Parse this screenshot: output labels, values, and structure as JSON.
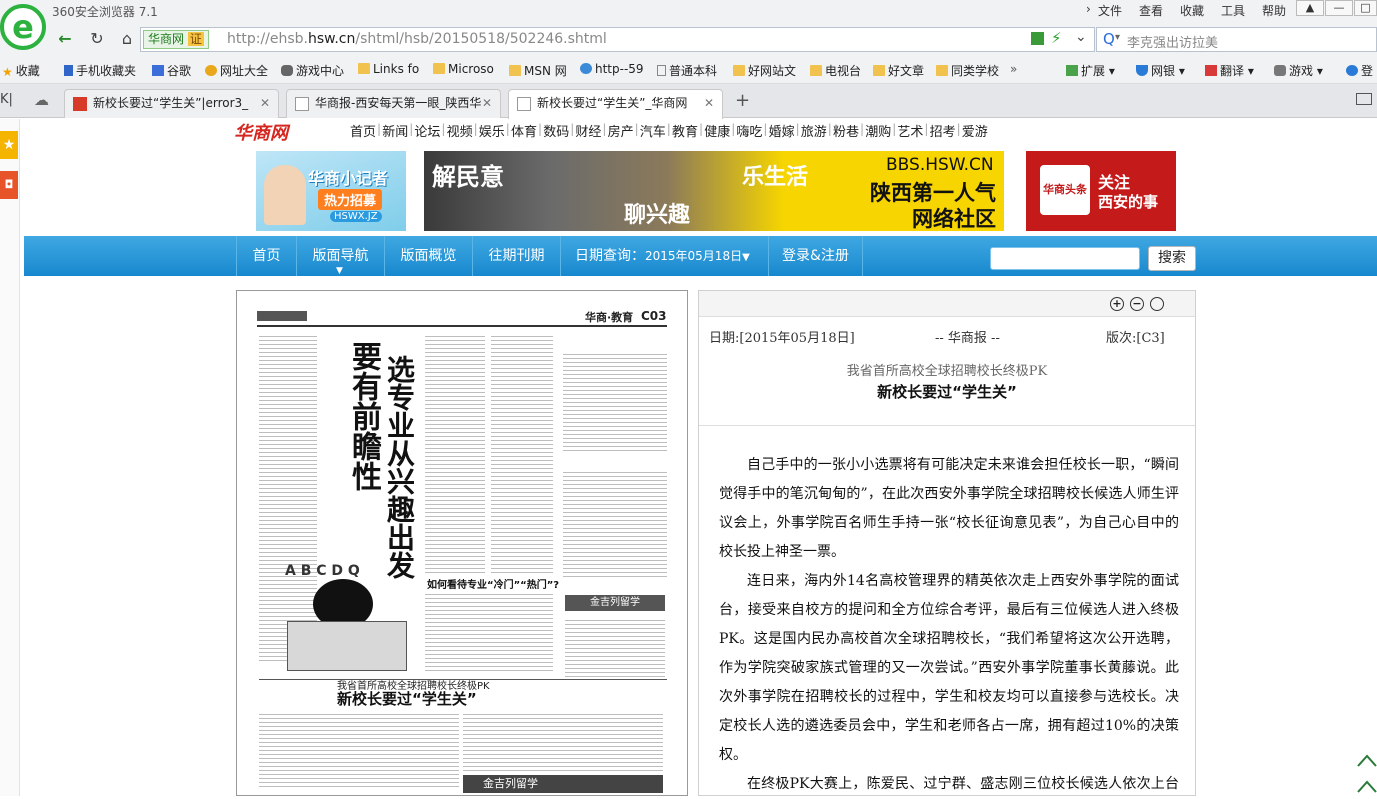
{
  "browser": {
    "app_title": "360安全浏览器 7.1",
    "menu": [
      "文件",
      "查看",
      "收藏",
      "工具",
      "帮助"
    ],
    "site_badge": "华商网",
    "site_badge_icon": "证",
    "url_prefix": "http://ehsb.",
    "url_domain": "hsw.cn",
    "url_path": "/shtml/hsb/20150518/502246.shtml",
    "search_placeholder": "李克强出访拉美"
  },
  "bookmarks": [
    {
      "label": "收藏",
      "icon": "star-icon"
    },
    {
      "label": "手机收藏夹",
      "icon": "phone-icon"
    },
    {
      "label": "谷歌",
      "icon": "google-icon"
    },
    {
      "label": "网址大全",
      "icon": "globe-icon"
    },
    {
      "label": "游戏中心",
      "icon": "gamepad-icon"
    },
    {
      "label": "Links fo",
      "icon": "folder-icon"
    },
    {
      "label": "Microso",
      "icon": "folder-icon"
    },
    {
      "label": "MSN 网",
      "icon": "folder-icon"
    },
    {
      "label": "http--59",
      "icon": "globe-icon"
    },
    {
      "label": "普通本科",
      "icon": "page-icon"
    },
    {
      "label": "好网站文",
      "icon": "folder-icon"
    },
    {
      "label": "电视台",
      "icon": "folder-icon"
    },
    {
      "label": "好文章",
      "icon": "folder-icon"
    },
    {
      "label": "同类学校",
      "icon": "folder-icon"
    }
  ],
  "bookmarks_right": [
    "扩展",
    "网银",
    "翻译",
    "游戏",
    "登"
  ],
  "tabs": [
    {
      "label": "新校长要过“学生关”|error3_"
    },
    {
      "label": "华商报-西安每天第一眼_陕西华"
    },
    {
      "label": "新校长要过“学生关”_华商网"
    }
  ],
  "site": {
    "logo": "华商网",
    "nav": [
      "首页",
      "新闻",
      "论坛",
      "视频",
      "娱乐",
      "体育",
      "数码",
      "财经",
      "房产",
      "汽车",
      "教育",
      "健康",
      "嗨吃",
      "婚嫁",
      "旅游",
      "粉巷",
      "潮购",
      "艺术",
      "招考",
      "爱游"
    ]
  },
  "banners": {
    "left_title": "华商小记者",
    "left_sub": "热力招募",
    "left_tag": "HSWX.JZ",
    "mid_a": "解民意",
    "mid_b": "聊兴趣",
    "mid_c": "乐生活",
    "mid_url": "BBS.HSW.CN",
    "mid_d": "陕西第一人气",
    "mid_e": "网络社区",
    "right_logo": "华商头条",
    "right_a": "关注",
    "right_b": "西安的事"
  },
  "blue_nav": {
    "items": [
      "首页",
      "版面导航",
      "版面概览",
      "往期刊期"
    ],
    "date_label": "日期查询：",
    "date_value": "2015年05月18日",
    "login": "登录&注册",
    "search_button": "搜索"
  },
  "paper": {
    "masthead": "华商·教育",
    "page_no": "C03",
    "headline_1": "要有前瞻性",
    "headline_2": "选专业从兴趣出发",
    "kicker": "我省首所高校全球招聘校长终极PK",
    "bottom_title": "新校长要过“学生关”",
    "side_title": "如何看待专业“冷门”“热门”?",
    "ad_1": "金吉列留学",
    "ad_2": "金吉列留学"
  },
  "article": {
    "date": "日期:[2015年05月18日]",
    "source": "-- 华商报 --",
    "edition": "版次:[C3]",
    "subtitle": "我省首所高校全球招聘校长终极PK",
    "title": "新校长要过“学生关”",
    "paragraphs": [
      "自己手中的一张小小选票将有可能决定未来谁会担任校长一职，“瞬间觉得手中的笔沉甸甸的”，在此次西安外事学院全球招聘校长候选人师生评议会上，外事学院百名师生手持一张“校长征询意见表”，为自己心目中的校长投上神圣一票。",
      "连日来，海内外14名高校管理界的精英依次走上西安外事学院的面试台，接受来自校方的提问和全方位综合考评，最后有三位候选人进入终极PK。这是国内民办高校首次全球招聘校长，“我们希望将这次公开选聘，作为学院突破家族式管理的又一次尝试。”西安外事学院董事长黄藤说。此次外事学院在招聘校长的过程中，学生和校友均可以直接参与选校长。决定校长人选的遴选委员会中，学生和老师各占一席，拥有超过10%的决策权。",
      "在终极PK大赛上，陈爱民、过宁群、盛志刚三位校长候选人依次上台演讲，各自讲述自己的"
    ]
  }
}
